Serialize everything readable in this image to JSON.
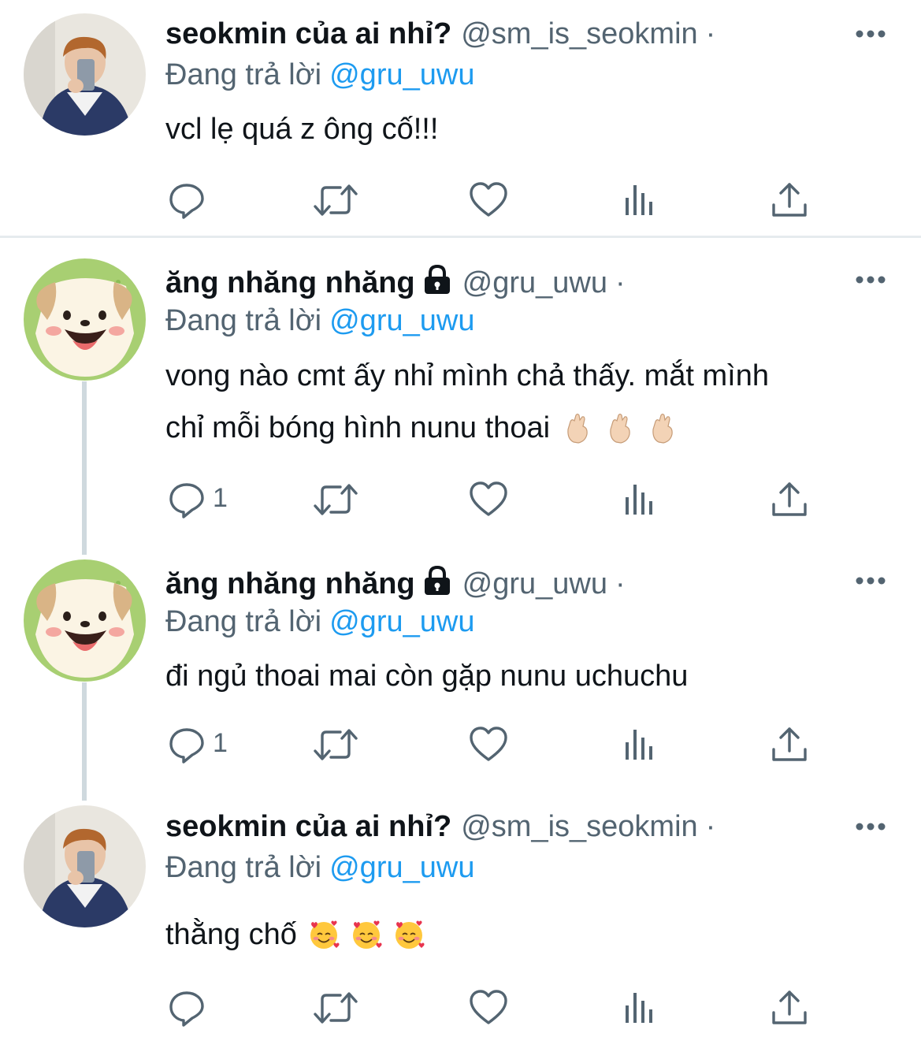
{
  "colors": {
    "link": "#1d9bf0",
    "muted": "#536471",
    "text": "#0f1419",
    "thread_line": "#cfd9de"
  },
  "tweets": [
    {
      "display_name": "seokmin của ai nhỉ?",
      "handle": "@sm_is_seokmin",
      "dot": "·",
      "replying_label": "Đang trả lời",
      "replying_handle": "@gru_uwu",
      "text_lines": [
        "vcl lẹ quá z ông cố!!!"
      ],
      "reply_count": "",
      "avatar": "selfie-avatar",
      "locked": false
    },
    {
      "display_name": "ăng nhăng nhăng",
      "handle": "@gru_uwu",
      "dot": "·",
      "replying_label": "Đang trả lời",
      "replying_handle": "@gru_uwu",
      "text_lines": [
        "vong nào cmt ấy nhỉ mình chả thấy. mắt mình",
        "chỉ mỗi bóng hình nunu thoai"
      ],
      "emoji": "crossed-fingers",
      "reply_count": "1",
      "avatar": "puppy-avatar",
      "locked": true
    },
    {
      "display_name": "ăng nhăng nhăng",
      "handle": "@gru_uwu",
      "dot": "·",
      "replying_label": "Đang trả lời",
      "replying_handle": "@gru_uwu",
      "text_lines": [
        "đi ngủ thoai mai còn gặp nunu uchuchu"
      ],
      "reply_count": "1",
      "avatar": "puppy-avatar",
      "locked": true
    },
    {
      "display_name": "seokmin của ai nhỉ?",
      "handle": "@sm_is_seokmin",
      "dot": "·",
      "replying_label": "Đang trả lời",
      "replying_handle": "@gru_uwu",
      "text_lines": [
        "thằng chố"
      ],
      "emoji": "smiling-face-with-hearts",
      "reply_count": "",
      "avatar": "selfie-avatar",
      "locked": false
    }
  ]
}
